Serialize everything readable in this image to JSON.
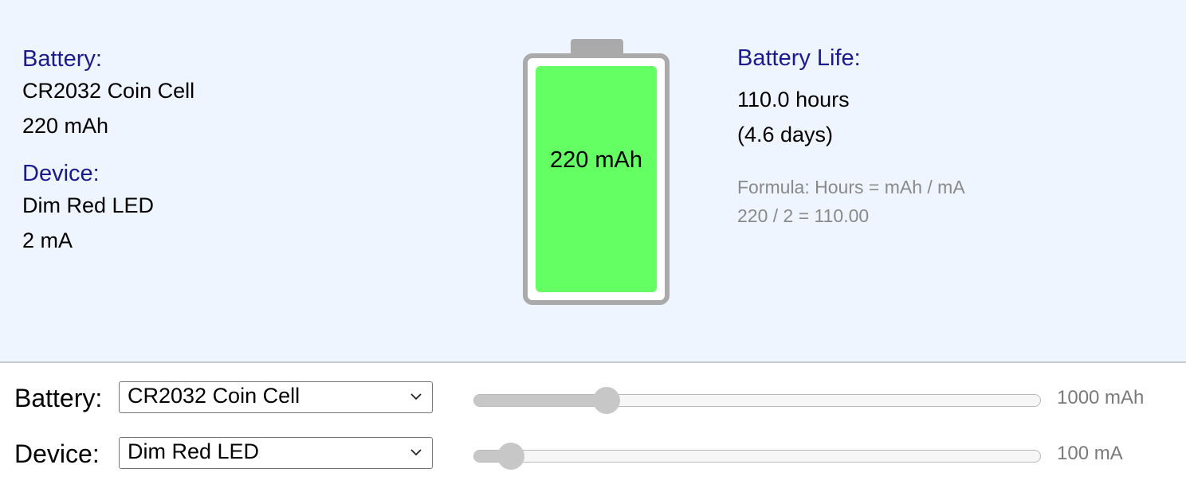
{
  "summary": {
    "battery_heading": "Battery:",
    "battery_name": "CR2032 Coin Cell",
    "battery_capacity": "220 mAh",
    "device_heading": "Device:",
    "device_name": "Dim Red LED",
    "device_current": "2 mA"
  },
  "battery_graphic": {
    "label": "220 mAh",
    "fill_fraction": 1.0,
    "fill_color": "#63ff63",
    "frame_color": "#aaaaaa"
  },
  "result": {
    "heading": "Battery Life:",
    "hours": "110.0 hours",
    "days": "(4.6 days)",
    "formula_line1": "Formula: Hours = mAh / mA",
    "formula_line2": "220 / 2 = 110.00"
  },
  "controls": {
    "battery": {
      "label": "Battery:",
      "selected": "CR2032 Coin Cell",
      "slider_max_label": "1000 mAh",
      "slider_value": 220,
      "slider_max": 1000
    },
    "device": {
      "label": "Device:",
      "selected": "Dim Red LED",
      "slider_max_label": "100 mA",
      "slider_value": 2,
      "slider_max": 100
    }
  },
  "colors": {
    "heading": "#1a1a8c",
    "panel_background": "#eef5fe",
    "muted_text": "#8a8a8a"
  }
}
